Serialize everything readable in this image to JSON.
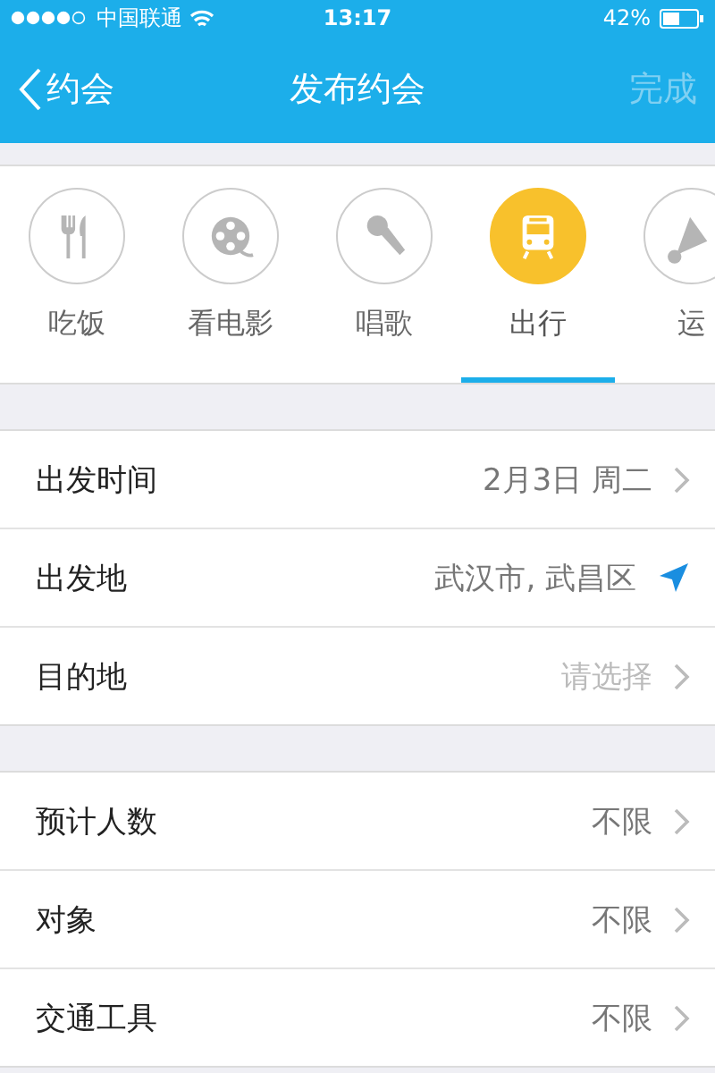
{
  "status_bar": {
    "carrier": "中国联通",
    "time": "13:17",
    "battery": "42%"
  },
  "nav": {
    "back": "约会",
    "title": "发布约会",
    "done": {
      "label": "完成",
      "disabled": true
    }
  },
  "categories": [
    {
      "kind": "dining",
      "label": "吃饭",
      "selected": false
    },
    {
      "kind": "film",
      "label": "看电影",
      "selected": false
    },
    {
      "kind": "mic",
      "label": "唱歌",
      "selected": false
    },
    {
      "kind": "bus",
      "label": "出行",
      "selected": true
    },
    {
      "kind": "shuttlecock",
      "label": "运",
      "selected": false
    }
  ],
  "sections": [
    {
      "rows": [
        {
          "label": "出发时间",
          "value": "2月3日 周二",
          "kind": "chevron"
        },
        {
          "label": "出发地",
          "value": "武汉市, 武昌区",
          "kind": "location"
        },
        {
          "label": "目的地",
          "placeholder": "请选择",
          "kind": "chevron"
        }
      ]
    },
    {
      "rows": [
        {
          "label": "预计人数",
          "value": "不限",
          "kind": "chevron"
        },
        {
          "label": "对象",
          "value": "不限",
          "kind": "chevron"
        },
        {
          "label": "交通工具",
          "value": "不限",
          "kind": "chevron"
        }
      ]
    }
  ]
}
